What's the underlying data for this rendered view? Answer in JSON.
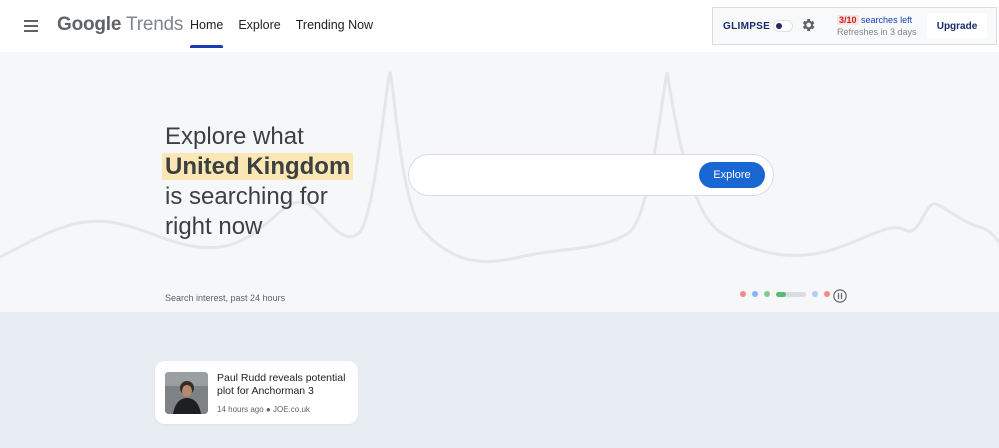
{
  "header": {
    "logo": {
      "google": "Google",
      "trends": "Trends"
    },
    "nav": [
      {
        "label": "Home",
        "active": true
      },
      {
        "label": "Explore",
        "active": false
      },
      {
        "label": "Trending Now",
        "active": false
      }
    ]
  },
  "glimpse": {
    "logo": "GLIMPSE",
    "count": "3/10",
    "searches_left": "searches left",
    "refresh": "Refreshes in 3 days",
    "upgrade_label": "Upgrade"
  },
  "hero": {
    "line1": "Explore what",
    "region": "United Kingdom",
    "line3": "is searching for",
    "line4": "right now",
    "search_placeholder": "",
    "explore_label": "Explore",
    "interest_label": "Search interest, past 24 hours"
  },
  "carousel": {
    "dot_colors": [
      "#f28b82",
      "#8ab4f8",
      "#81c995",
      "#aecbfa",
      "#c58af9",
      "#f28b82"
    ]
  },
  "story": {
    "title": "Paul Rudd reveals potential plot for Anchorman 3",
    "time": "14 hours ago",
    "source": "JOE.co.uk"
  }
}
